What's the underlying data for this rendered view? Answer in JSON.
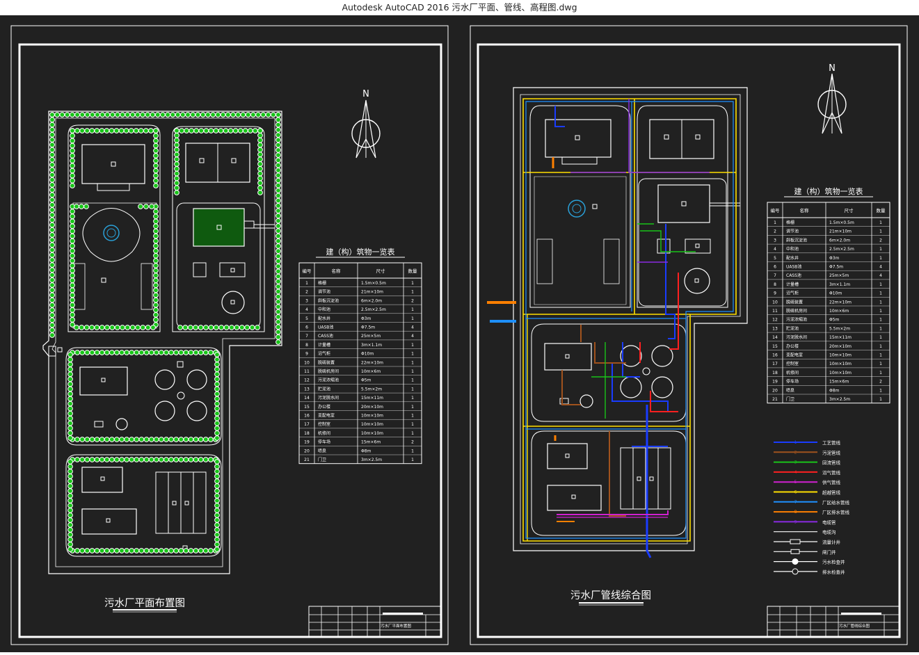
{
  "window": {
    "title": "Autodesk AutoCAD 2016    污水厂平面、管线、高程图.dwg"
  },
  "colors": {
    "background": "#212121",
    "line": "#ffffff",
    "tree": "#19c419",
    "legend": [
      "#1a3cff",
      "#a0521d",
      "#19c419",
      "#ff2020",
      "#d020d0",
      "#ffe000",
      "#1e90ff",
      "#ff8000",
      "#8a2be2"
    ]
  },
  "north_label": "N",
  "left_sheet": {
    "title": "污水厂平面布置图",
    "table": {
      "title": "建（构）筑物一览表",
      "headers": [
        "编号",
        "名称",
        "尺寸",
        "数量"
      ],
      "rows": [
        [
          "1",
          "格栅",
          "1.5m×0.5m",
          "1"
        ],
        [
          "2",
          "调节池",
          "21m×10m",
          "1"
        ],
        [
          "3",
          "斜板沉淀池",
          "6m×2.0m",
          "2"
        ],
        [
          "4",
          "中和池",
          "2.5m×2.5m",
          "1"
        ],
        [
          "5",
          "配水井",
          "Φ3m",
          "1"
        ],
        [
          "6",
          "UASB池",
          "Φ7.5m",
          "4"
        ],
        [
          "7",
          "CASS池",
          "25m×5m",
          "4"
        ],
        [
          "8",
          "计量槽",
          "3m×1.1m",
          "1"
        ],
        [
          "9",
          "沼气柜",
          "Φ10m",
          "1"
        ],
        [
          "10",
          "脱硫装置",
          "22m×10m",
          "1"
        ],
        [
          "11",
          "脱硫机房间",
          "10m×6m",
          "1"
        ],
        [
          "12",
          "污泥浓缩池",
          "Φ5m",
          "1"
        ],
        [
          "13",
          "贮泥池",
          "5.5m×2m",
          "1"
        ],
        [
          "14",
          "污泥脱水间",
          "15m×11m",
          "1"
        ],
        [
          "15",
          "办公楼",
          "20m×10m",
          "1"
        ],
        [
          "16",
          "变配电室",
          "10m×10m",
          "1"
        ],
        [
          "17",
          "控制室",
          "10m×10m",
          "1"
        ],
        [
          "18",
          "机修间",
          "10m×10m",
          "1"
        ],
        [
          "19",
          "停车场",
          "15m×6m",
          "2"
        ],
        [
          "20",
          "喷泉",
          "Φ8m",
          "1"
        ],
        [
          "21",
          "门卫",
          "3m×2.5m",
          "1"
        ]
      ]
    }
  },
  "right_sheet": {
    "title": "污水厂管线综合图",
    "table": {
      "title": "建（构）筑物一览表",
      "headers": [
        "编号",
        "名称",
        "尺寸",
        "数量"
      ],
      "rows": [
        [
          "1",
          "格栅",
          "1.5m×0.5m",
          "1"
        ],
        [
          "2",
          "调节池",
          "21m×10m",
          "1"
        ],
        [
          "3",
          "斜板沉淀池",
          "6m×2.0m",
          "2"
        ],
        [
          "4",
          "中和池",
          "2.5m×2.5m",
          "1"
        ],
        [
          "5",
          "配水井",
          "Φ3m",
          "1"
        ],
        [
          "6",
          "UASB池",
          "Φ7.5m",
          "4"
        ],
        [
          "7",
          "CASS池",
          "25m×5m",
          "4"
        ],
        [
          "8",
          "计量槽",
          "3m×1.1m",
          "1"
        ],
        [
          "9",
          "沼气柜",
          "Φ10m",
          "1"
        ],
        [
          "10",
          "脱硫装置",
          "22m×10m",
          "1"
        ],
        [
          "11",
          "脱硫机房间",
          "10m×6m",
          "1"
        ],
        [
          "12",
          "污泥浓缩池",
          "Φ5m",
          "1"
        ],
        [
          "13",
          "贮泥池",
          "5.5m×2m",
          "1"
        ],
        [
          "14",
          "污泥脱水间",
          "15m×11m",
          "1"
        ],
        [
          "15",
          "办公楼",
          "20m×10m",
          "1"
        ],
        [
          "16",
          "变配电室",
          "10m×10m",
          "1"
        ],
        [
          "17",
          "控制室",
          "10m×10m",
          "1"
        ],
        [
          "18",
          "机修间",
          "10m×10m",
          "1"
        ],
        [
          "19",
          "停车场",
          "15m×6m",
          "2"
        ],
        [
          "20",
          "喷泉",
          "Φ8m",
          "1"
        ],
        [
          "21",
          "门卫",
          "3m×2.5m",
          "1"
        ]
      ]
    },
    "legend": [
      {
        "num": "1",
        "label": "工艺管线"
      },
      {
        "num": "2",
        "label": "污泥管线"
      },
      {
        "num": "3",
        "label": "回流管线"
      },
      {
        "num": "4",
        "label": "沼气管线"
      },
      {
        "num": "5",
        "label": "供气管线"
      },
      {
        "num": "6",
        "label": "超越管线"
      },
      {
        "num": "7",
        "label": "厂区给水管线"
      },
      {
        "num": "8",
        "label": "厂区排水管线"
      },
      {
        "num": "9",
        "label": "电缆管"
      },
      {
        "num": "",
        "label": "电缆沟"
      },
      {
        "num": "",
        "label": "流量计井"
      },
      {
        "num": "",
        "label": "闸门井"
      },
      {
        "num": "",
        "label": "污水检查井"
      },
      {
        "num": "",
        "label": "排水检查井"
      }
    ]
  },
  "title_blocks": {
    "left_name": "污水厂平面布置图",
    "right_name": "污水厂管线综合图"
  }
}
